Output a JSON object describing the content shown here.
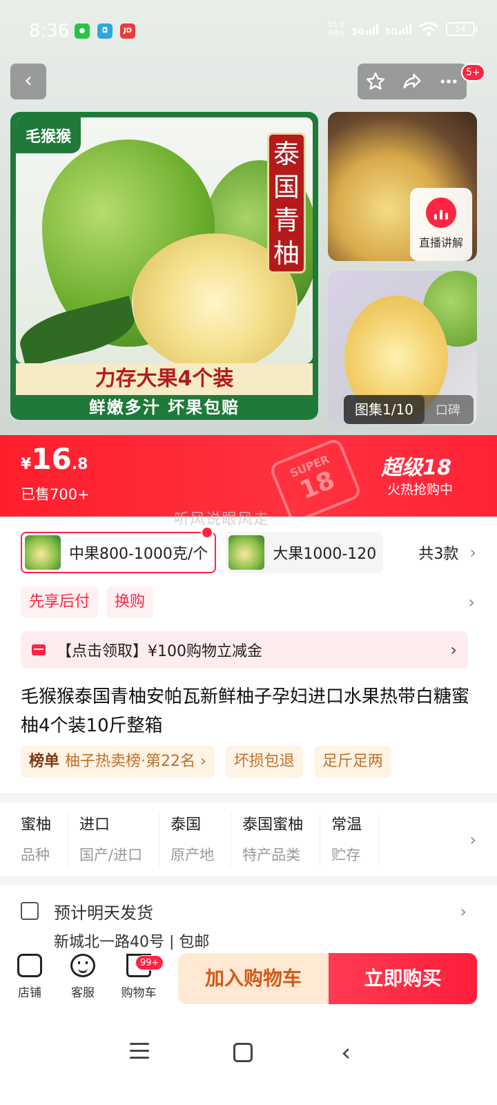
{
  "status": {
    "time": "8:36",
    "apps": [
      "wechat-icon",
      "app-icon",
      "jd-icon"
    ],
    "jd_label": "JD",
    "speed": "55.8",
    "speed_unit": "KB/s",
    "sig1": "5G",
    "sig2": "5G",
    "battery": "54"
  },
  "header": {
    "badge": "5+"
  },
  "gallery": {
    "brand": "毛猴猴",
    "title_tag": "泰国青柚",
    "banner_line1": "力存大果4个装",
    "banner_line2": "鲜嫩多汁  坏果包赔",
    "live_label": "直播讲解",
    "count": "图集1/10",
    "reviews": "口碑"
  },
  "price_bar": {
    "currency": "¥",
    "price_int": "16",
    "price_dec": ".8",
    "sold": "已售700+",
    "stamp_top": "SUPER",
    "stamp_num": "18",
    "promo_title": "超级18",
    "promo_sub": "火热抢购中"
  },
  "watermark": "听风说眼风走",
  "variants": {
    "items": [
      {
        "label": "中果800-1000克/个",
        "selected": true
      },
      {
        "label": "大果1000-120",
        "selected": false
      }
    ],
    "total": "共3款"
  },
  "tags": [
    "先享后付",
    "换购"
  ],
  "coupon": "【点击领取】¥100购物立减金",
  "product": {
    "title": "毛猴猴泰国青柚安帕瓦新鲜柚子孕妇进口水果热带白糖蜜柚4个装10斤整箱",
    "rank_label": "榜单",
    "rank_text": "柚子热卖榜·第22名 ›",
    "guarantee1": "坏损包退",
    "guarantee2": "足斤足两"
  },
  "attributes": [
    {
      "value": "蜜柚",
      "key": "品种"
    },
    {
      "value": "进口",
      "key": "国产/进口"
    },
    {
      "value": "泰国",
      "key": "原产地"
    },
    {
      "value": "泰国蜜柚",
      "key": "特产品类"
    },
    {
      "value": "常温",
      "key": "贮存"
    }
  ],
  "shipping": {
    "title": "预计明天发货",
    "sub": "新城北一路40号 | 包邮"
  },
  "bottom_bar": {
    "store": "店铺",
    "service": "客服",
    "cart": "购物车",
    "cart_badge": "99+",
    "add_to_cart": "加入购物车",
    "buy_now": "立即购买"
  },
  "colors": {
    "accent_red": "#ff2442",
    "price_bar": "#ff1e2c",
    "brand_green": "#1f7a3a"
  }
}
